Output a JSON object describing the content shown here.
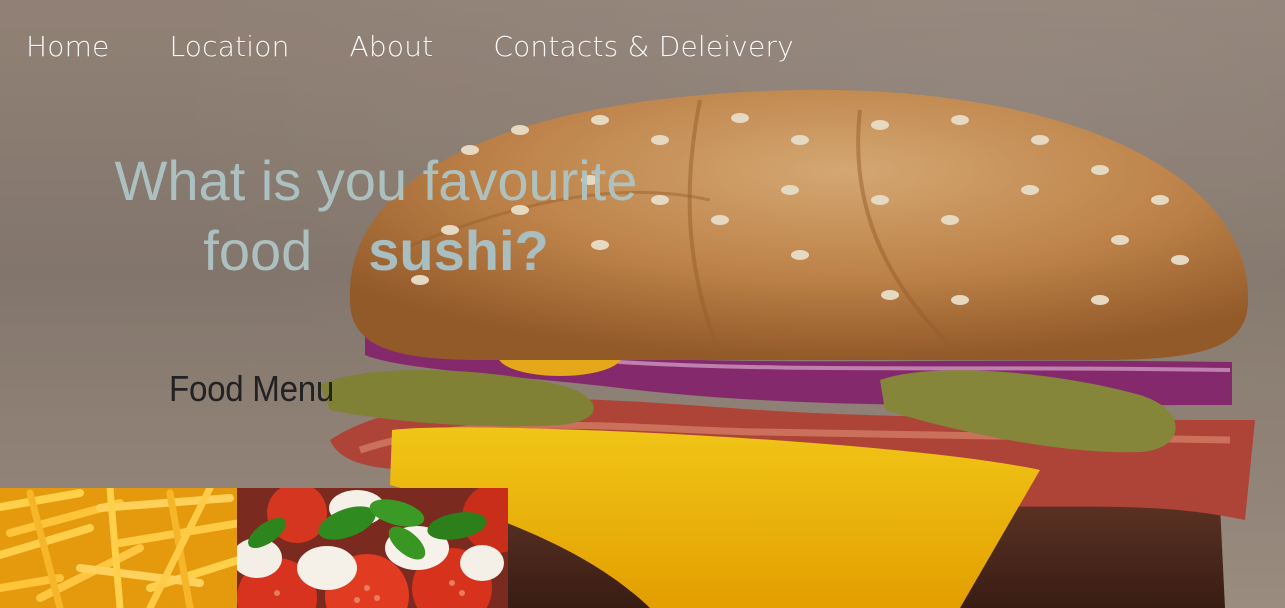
{
  "nav": {
    "items": [
      {
        "label": "Home"
      },
      {
        "label": "Location"
      },
      {
        "label": "About"
      },
      {
        "label": "Contacts & Deleivery"
      }
    ]
  },
  "hero": {
    "headline_line1": "What is you favourite",
    "headline_word": "food",
    "headline_dish": "sushi?",
    "background_image": "burger-photo"
  },
  "menu": {
    "title": "Food Menu",
    "thumbnails": [
      {
        "image": "french-fries-photo"
      },
      {
        "image": "caprese-salad-photo"
      }
    ]
  },
  "colors": {
    "nav_text": "#ffffff",
    "headline_text": "#aec4c4",
    "menu_title_text": "#222222"
  }
}
